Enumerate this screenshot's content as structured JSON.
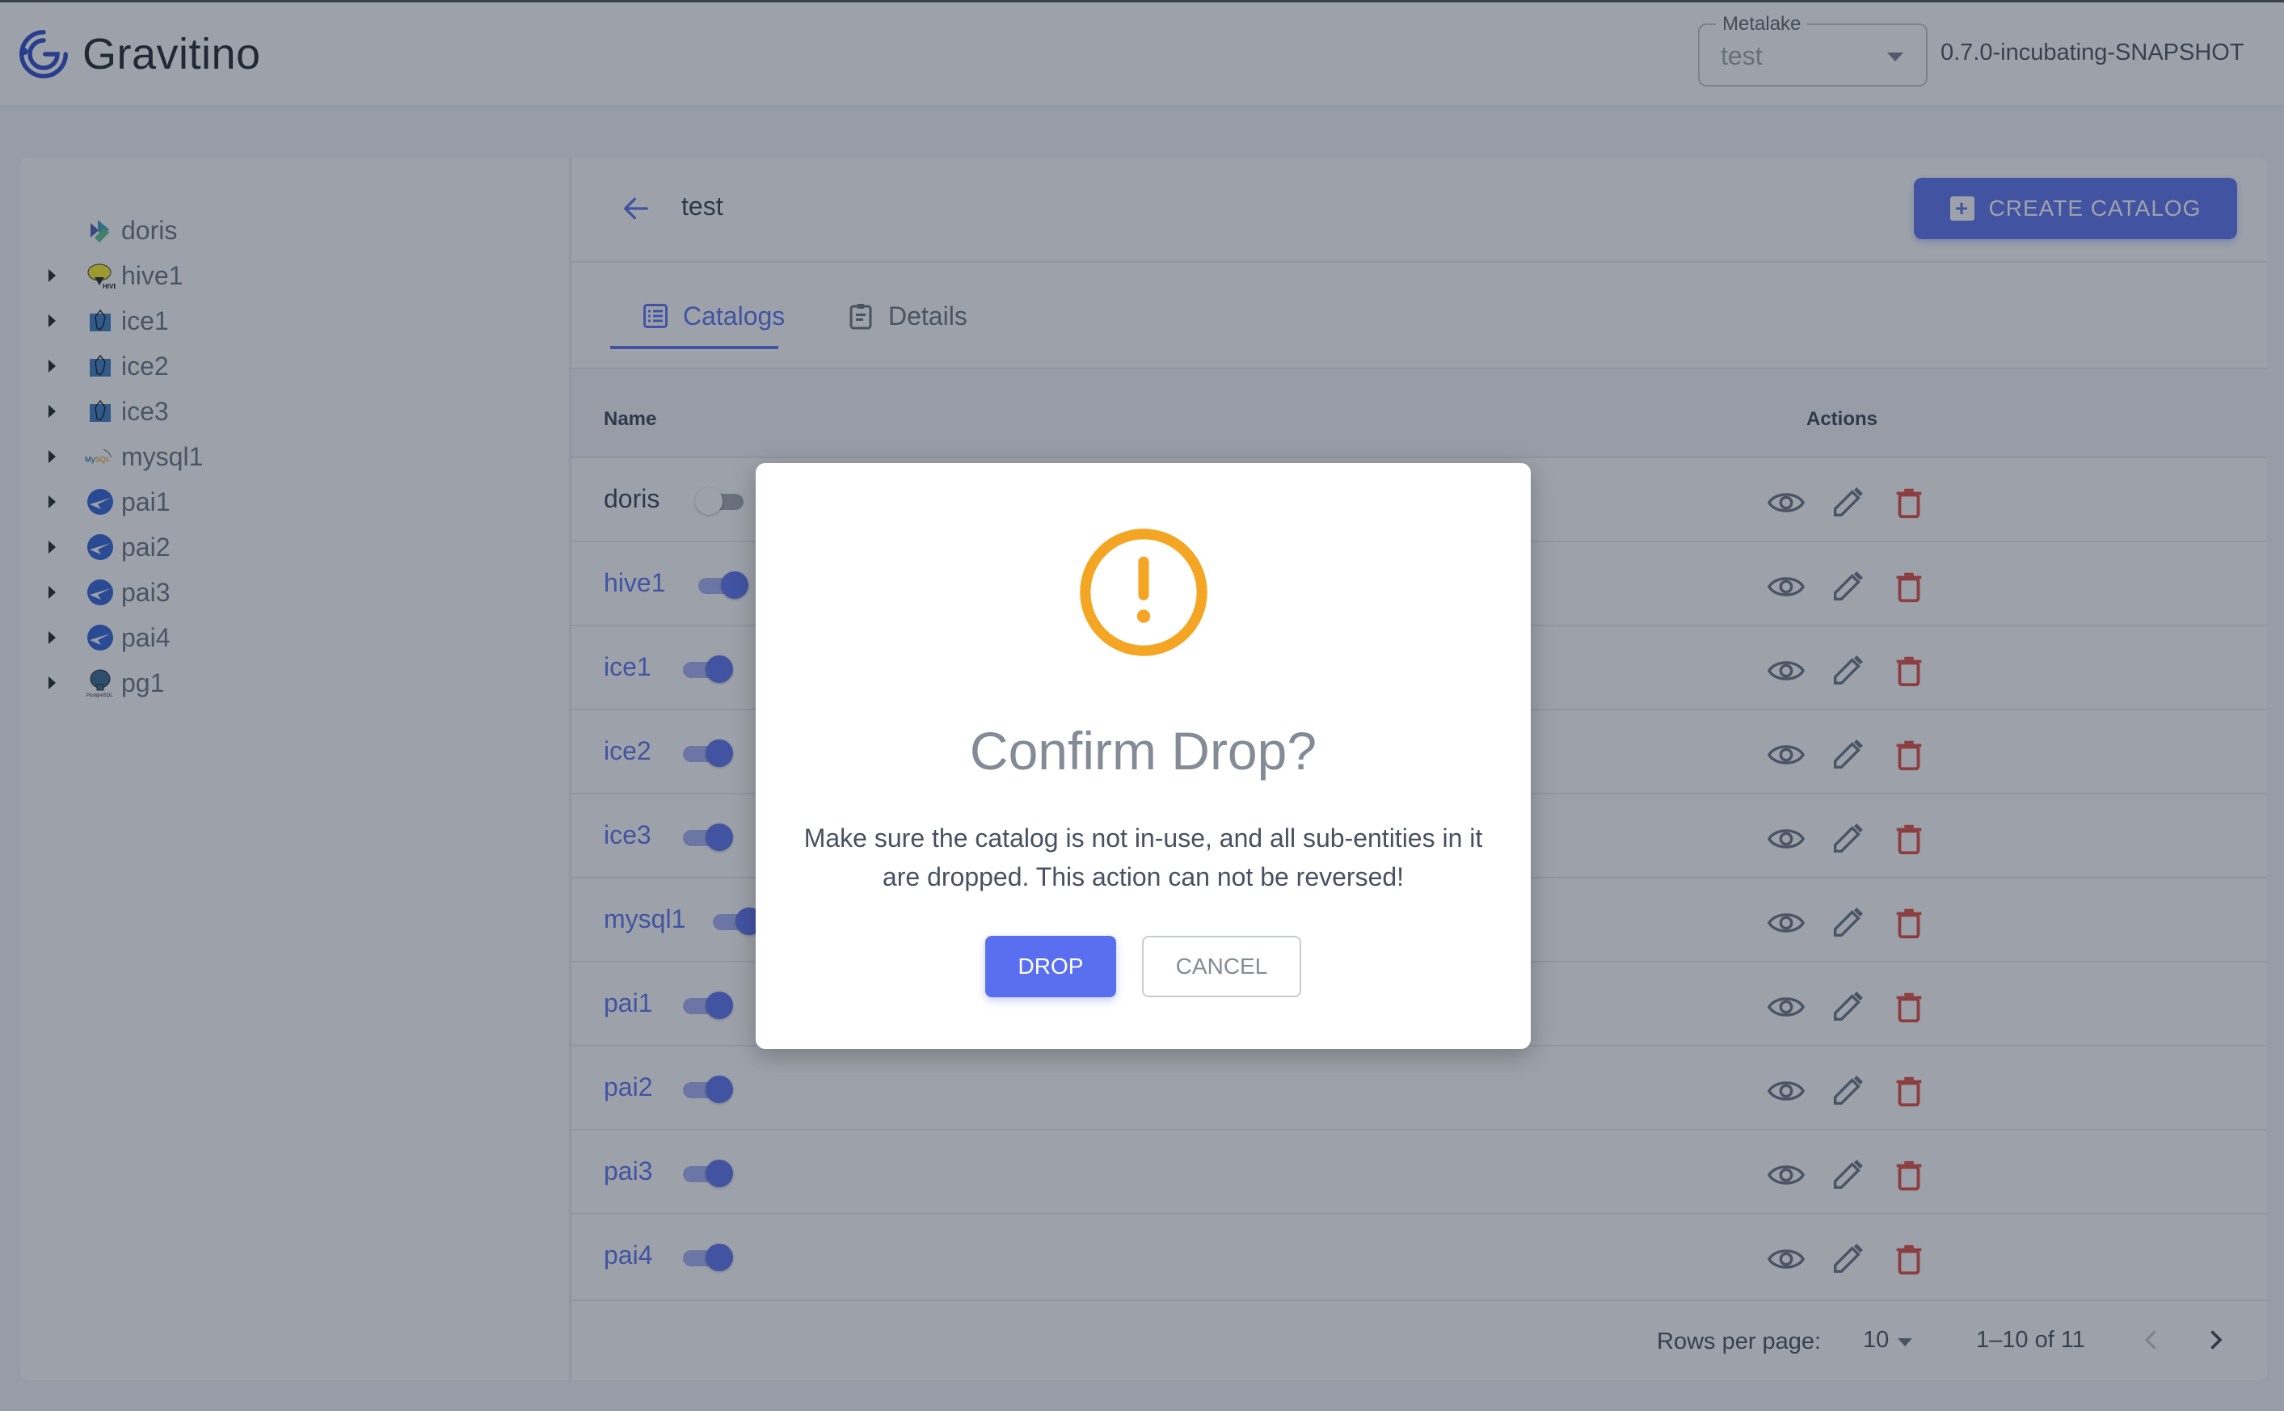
{
  "header": {
    "app_name": "Gravitino",
    "metalake_label": "Metalake",
    "metalake_value": "test",
    "version": "0.7.0-incubating-SNAPSHOT"
  },
  "sidebar": {
    "items": [
      {
        "label": "doris",
        "icon": "doris-icon",
        "expandable": false
      },
      {
        "label": "hive1",
        "icon": "hive-icon",
        "expandable": true
      },
      {
        "label": "ice1",
        "icon": "iceberg-icon",
        "expandable": true
      },
      {
        "label": "ice2",
        "icon": "iceberg-icon",
        "expandable": true
      },
      {
        "label": "ice3",
        "icon": "iceberg-icon",
        "expandable": true
      },
      {
        "label": "mysql1",
        "icon": "mysql-icon",
        "expandable": true
      },
      {
        "label": "pai1",
        "icon": "paimon-icon",
        "expandable": true
      },
      {
        "label": "pai2",
        "icon": "paimon-icon",
        "expandable": true
      },
      {
        "label": "pai3",
        "icon": "paimon-icon",
        "expandable": true
      },
      {
        "label": "pai4",
        "icon": "paimon-icon",
        "expandable": true
      },
      {
        "label": "pg1",
        "icon": "postgresql-icon",
        "expandable": true
      }
    ]
  },
  "main": {
    "breadcrumb": "test",
    "create_button": "CREATE CATALOG",
    "tabs": [
      {
        "label": "Catalogs",
        "active": true
      },
      {
        "label": "Details",
        "active": false
      }
    ],
    "table": {
      "columns": [
        "Name",
        "Actions"
      ],
      "rows": [
        {
          "name": "doris",
          "in_use": false
        },
        {
          "name": "hive1",
          "in_use": true
        },
        {
          "name": "ice1",
          "in_use": true
        },
        {
          "name": "ice2",
          "in_use": true
        },
        {
          "name": "ice3",
          "in_use": true
        },
        {
          "name": "mysql1",
          "in_use": true
        },
        {
          "name": "pai1",
          "in_use": true
        },
        {
          "name": "pai2",
          "in_use": true
        },
        {
          "name": "pai3",
          "in_use": true
        },
        {
          "name": "pai4",
          "in_use": true
        }
      ]
    },
    "pagination": {
      "rows_per_page_label": "Rows per page:",
      "rows_per_page": "10",
      "range": "1–10 of 11"
    }
  },
  "dialog": {
    "title": "Confirm Drop?",
    "message": "Make sure the catalog is not in-use, and all sub-entities in it are dropped. This action can not be reversed!",
    "confirm_label": "DROP",
    "cancel_label": "CANCEL"
  },
  "colors": {
    "primary": "#5a6ff0",
    "warning": "#f5a524",
    "danger": "#e0483e"
  }
}
